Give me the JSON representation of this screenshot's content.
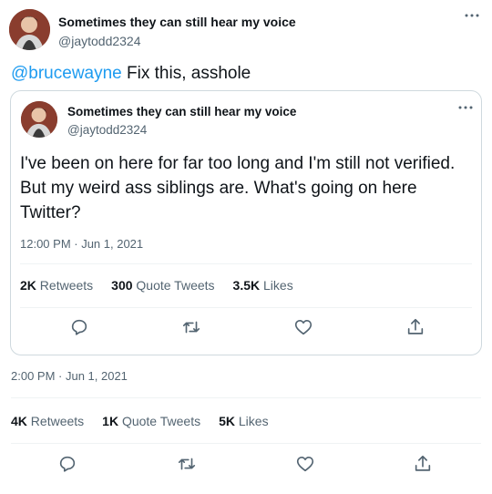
{
  "main_tweet": {
    "display_name": "Sometimes they can still hear my voice",
    "handle": "@jaytodd2324",
    "mention": "@brucewayne",
    "text": " Fix this, asshole",
    "timestamp": "2:00 PM · Jun 1, 2021",
    "stats": {
      "retweets_count": "4K",
      "retweets_label": "Retweets",
      "quotes_count": "1K",
      "quotes_label": "Quote Tweets",
      "likes_count": "5K",
      "likes_label": "Likes"
    }
  },
  "quoted_tweet": {
    "display_name": "Sometimes they can still hear my voice",
    "handle": "@jaytodd2324",
    "text": "I've been on here for far too long and I'm still not verified. But my weird ass siblings are. What's going on here Twitter?",
    "timestamp": "12:00 PM · Jun 1, 2021",
    "stats": {
      "retweets_count": "2K",
      "retweets_label": "Retweets",
      "quotes_count": "300",
      "quotes_label": "Quote Tweets",
      "likes_count": "3.5K",
      "likes_label": "Likes"
    }
  },
  "icons": [
    "more-icon",
    "reply-icon",
    "retweet-icon",
    "like-icon",
    "share-icon"
  ],
  "colors": {
    "accent": "#1d9bf0",
    "text": "#0f1419",
    "secondary": "#536471",
    "border": "#cfd9de"
  }
}
